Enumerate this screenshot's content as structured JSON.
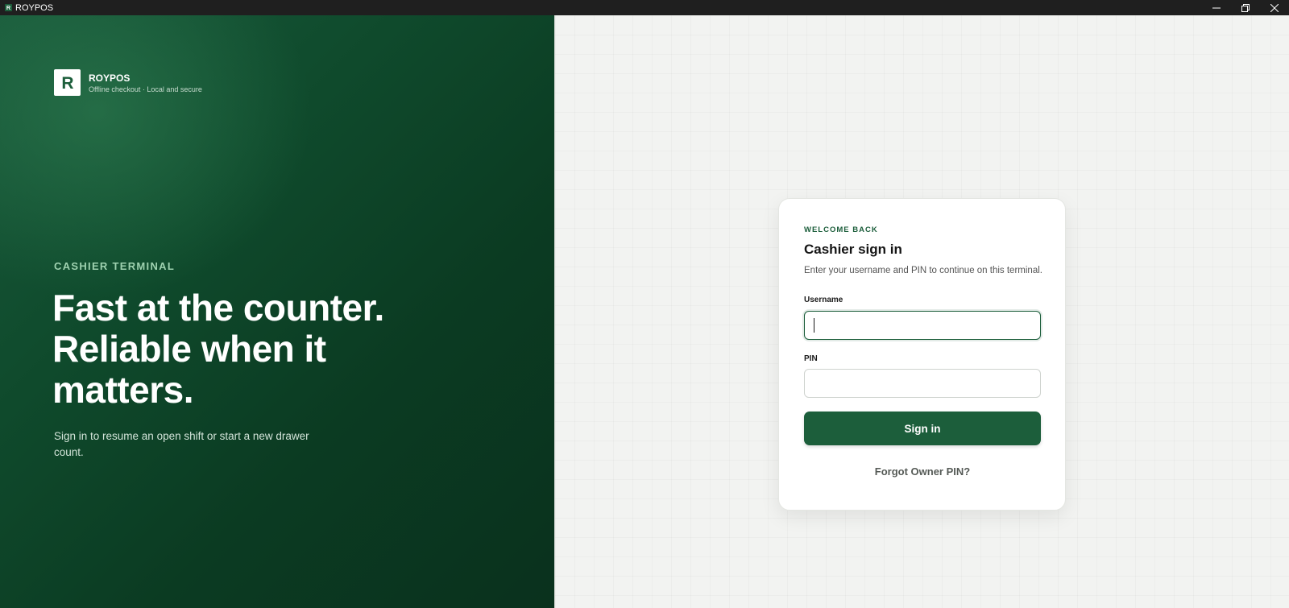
{
  "window": {
    "title": "ROYPOS",
    "controls": {
      "minimize_icon": "minimize-icon",
      "restore_icon": "restore-icon",
      "close_icon": "close-icon"
    }
  },
  "brand": {
    "logo_letter": "R",
    "name": "ROYPOS",
    "tagline": "Offline checkout · Local and secure"
  },
  "hero": {
    "eyebrow": "CASHIER TERMINAL",
    "headline": "Fast at the counter. Reliable when it matters.",
    "subtext": "Sign in to resume an open shift or start a new drawer count."
  },
  "login": {
    "eyebrow": "WELCOME BACK",
    "title": "Cashier sign in",
    "subtitle": "Enter your username and PIN to continue on this terminal.",
    "username_label": "Username",
    "username_value": "",
    "pin_label": "PIN",
    "pin_value": "",
    "submit_label": "Sign in",
    "forgot_label": "Forgot Owner PIN?"
  },
  "colors": {
    "brand_green": "#1c5e3b",
    "titlebar": "#1f1f1f",
    "hero_eyebrow": "#9fd2b0"
  }
}
